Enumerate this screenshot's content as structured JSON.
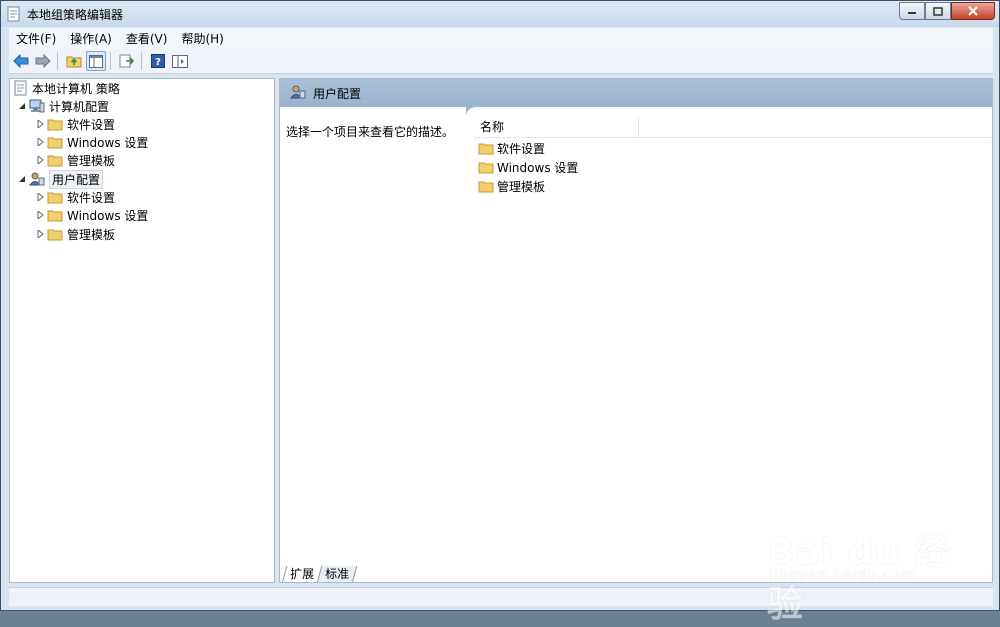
{
  "window": {
    "title": "本地组策略编辑器"
  },
  "menu": [
    {
      "label": "文件(F)"
    },
    {
      "label": "操作(A)"
    },
    {
      "label": "查看(V)"
    },
    {
      "label": "帮助(H)"
    }
  ],
  "toolbar": {
    "icons": [
      "back-arrow-icon",
      "forward-arrow-icon",
      "up-folder-icon",
      "show-hide-tree-icon",
      "export-list-icon",
      "help-icon",
      "properties-icon"
    ]
  },
  "tree": {
    "root": "本地计算机 策略",
    "computer_config": "计算机配置",
    "user_config": "用户配置",
    "computer_children": [
      "软件设置",
      "Windows 设置",
      "管理模板"
    ],
    "user_children": [
      "软件设置",
      "Windows 设置",
      "管理模板"
    ]
  },
  "content": {
    "header_title": "用户配置",
    "description": "选择一个项目来查看它的描述。",
    "column_name": "名称",
    "items": [
      "软件设置",
      "Windows 设置",
      "管理模板"
    ]
  },
  "tabs": [
    {
      "label": "扩展",
      "active": true
    },
    {
      "label": "标准",
      "active": false
    }
  ],
  "watermark": {
    "main": "Bai du 经验",
    "sub": "jingyan.baidu.com"
  },
  "colors": {
    "header_blue": "#9ab3cf",
    "folder_yellow": "#f2cf6b",
    "close_red": "#c7402a"
  }
}
